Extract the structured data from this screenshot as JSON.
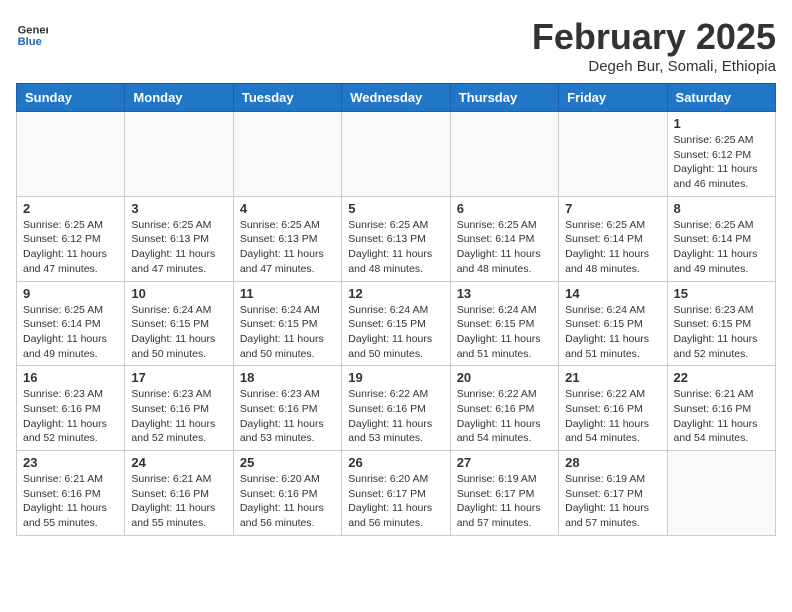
{
  "header": {
    "logo_general": "General",
    "logo_blue": "Blue",
    "month_year": "February 2025",
    "location": "Degeh Bur, Somali, Ethiopia"
  },
  "weekdays": [
    "Sunday",
    "Monday",
    "Tuesday",
    "Wednesday",
    "Thursday",
    "Friday",
    "Saturday"
  ],
  "weeks": [
    [
      {
        "day": "",
        "info": ""
      },
      {
        "day": "",
        "info": ""
      },
      {
        "day": "",
        "info": ""
      },
      {
        "day": "",
        "info": ""
      },
      {
        "day": "",
        "info": ""
      },
      {
        "day": "",
        "info": ""
      },
      {
        "day": "1",
        "info": "Sunrise: 6:25 AM\nSunset: 6:12 PM\nDaylight: 11 hours\nand 46 minutes."
      }
    ],
    [
      {
        "day": "2",
        "info": "Sunrise: 6:25 AM\nSunset: 6:12 PM\nDaylight: 11 hours\nand 47 minutes."
      },
      {
        "day": "3",
        "info": "Sunrise: 6:25 AM\nSunset: 6:13 PM\nDaylight: 11 hours\nand 47 minutes."
      },
      {
        "day": "4",
        "info": "Sunrise: 6:25 AM\nSunset: 6:13 PM\nDaylight: 11 hours\nand 47 minutes."
      },
      {
        "day": "5",
        "info": "Sunrise: 6:25 AM\nSunset: 6:13 PM\nDaylight: 11 hours\nand 48 minutes."
      },
      {
        "day": "6",
        "info": "Sunrise: 6:25 AM\nSunset: 6:14 PM\nDaylight: 11 hours\nand 48 minutes."
      },
      {
        "day": "7",
        "info": "Sunrise: 6:25 AM\nSunset: 6:14 PM\nDaylight: 11 hours\nand 48 minutes."
      },
      {
        "day": "8",
        "info": "Sunrise: 6:25 AM\nSunset: 6:14 PM\nDaylight: 11 hours\nand 49 minutes."
      }
    ],
    [
      {
        "day": "9",
        "info": "Sunrise: 6:25 AM\nSunset: 6:14 PM\nDaylight: 11 hours\nand 49 minutes."
      },
      {
        "day": "10",
        "info": "Sunrise: 6:24 AM\nSunset: 6:15 PM\nDaylight: 11 hours\nand 50 minutes."
      },
      {
        "day": "11",
        "info": "Sunrise: 6:24 AM\nSunset: 6:15 PM\nDaylight: 11 hours\nand 50 minutes."
      },
      {
        "day": "12",
        "info": "Sunrise: 6:24 AM\nSunset: 6:15 PM\nDaylight: 11 hours\nand 50 minutes."
      },
      {
        "day": "13",
        "info": "Sunrise: 6:24 AM\nSunset: 6:15 PM\nDaylight: 11 hours\nand 51 minutes."
      },
      {
        "day": "14",
        "info": "Sunrise: 6:24 AM\nSunset: 6:15 PM\nDaylight: 11 hours\nand 51 minutes."
      },
      {
        "day": "15",
        "info": "Sunrise: 6:23 AM\nSunset: 6:15 PM\nDaylight: 11 hours\nand 52 minutes."
      }
    ],
    [
      {
        "day": "16",
        "info": "Sunrise: 6:23 AM\nSunset: 6:16 PM\nDaylight: 11 hours\nand 52 minutes."
      },
      {
        "day": "17",
        "info": "Sunrise: 6:23 AM\nSunset: 6:16 PM\nDaylight: 11 hours\nand 52 minutes."
      },
      {
        "day": "18",
        "info": "Sunrise: 6:23 AM\nSunset: 6:16 PM\nDaylight: 11 hours\nand 53 minutes."
      },
      {
        "day": "19",
        "info": "Sunrise: 6:22 AM\nSunset: 6:16 PM\nDaylight: 11 hours\nand 53 minutes."
      },
      {
        "day": "20",
        "info": "Sunrise: 6:22 AM\nSunset: 6:16 PM\nDaylight: 11 hours\nand 54 minutes."
      },
      {
        "day": "21",
        "info": "Sunrise: 6:22 AM\nSunset: 6:16 PM\nDaylight: 11 hours\nand 54 minutes."
      },
      {
        "day": "22",
        "info": "Sunrise: 6:21 AM\nSunset: 6:16 PM\nDaylight: 11 hours\nand 54 minutes."
      }
    ],
    [
      {
        "day": "23",
        "info": "Sunrise: 6:21 AM\nSunset: 6:16 PM\nDaylight: 11 hours\nand 55 minutes."
      },
      {
        "day": "24",
        "info": "Sunrise: 6:21 AM\nSunset: 6:16 PM\nDaylight: 11 hours\nand 55 minutes."
      },
      {
        "day": "25",
        "info": "Sunrise: 6:20 AM\nSunset: 6:16 PM\nDaylight: 11 hours\nand 56 minutes."
      },
      {
        "day": "26",
        "info": "Sunrise: 6:20 AM\nSunset: 6:17 PM\nDaylight: 11 hours\nand 56 minutes."
      },
      {
        "day": "27",
        "info": "Sunrise: 6:19 AM\nSunset: 6:17 PM\nDaylight: 11 hours\nand 57 minutes."
      },
      {
        "day": "28",
        "info": "Sunrise: 6:19 AM\nSunset: 6:17 PM\nDaylight: 11 hours\nand 57 minutes."
      },
      {
        "day": "",
        "info": ""
      }
    ]
  ]
}
